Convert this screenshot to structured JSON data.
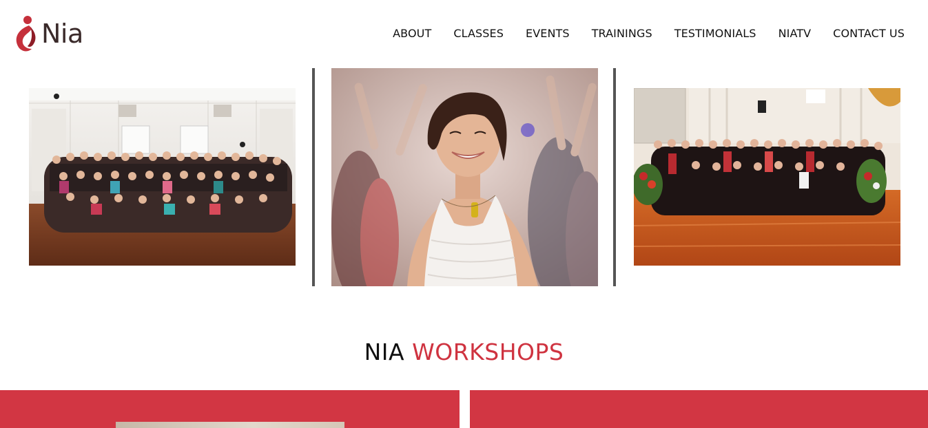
{
  "brand": {
    "logo_text": "Nia",
    "accent_color": "#cf3340",
    "card_color": "#d23643"
  },
  "nav": {
    "items": [
      "ABOUT",
      "CLASSES",
      "EVENTS",
      "TRAININGS",
      "TESTIMONIALS",
      "NIATV",
      "CONTACT US"
    ]
  },
  "photos": [
    {
      "name": "group-photo-studio"
    },
    {
      "name": "smiling-dancer-photo"
    },
    {
      "name": "group-photo-hall"
    }
  ],
  "section": {
    "title_part1": "NIA",
    "title_part2": "WORKSHOPS"
  }
}
